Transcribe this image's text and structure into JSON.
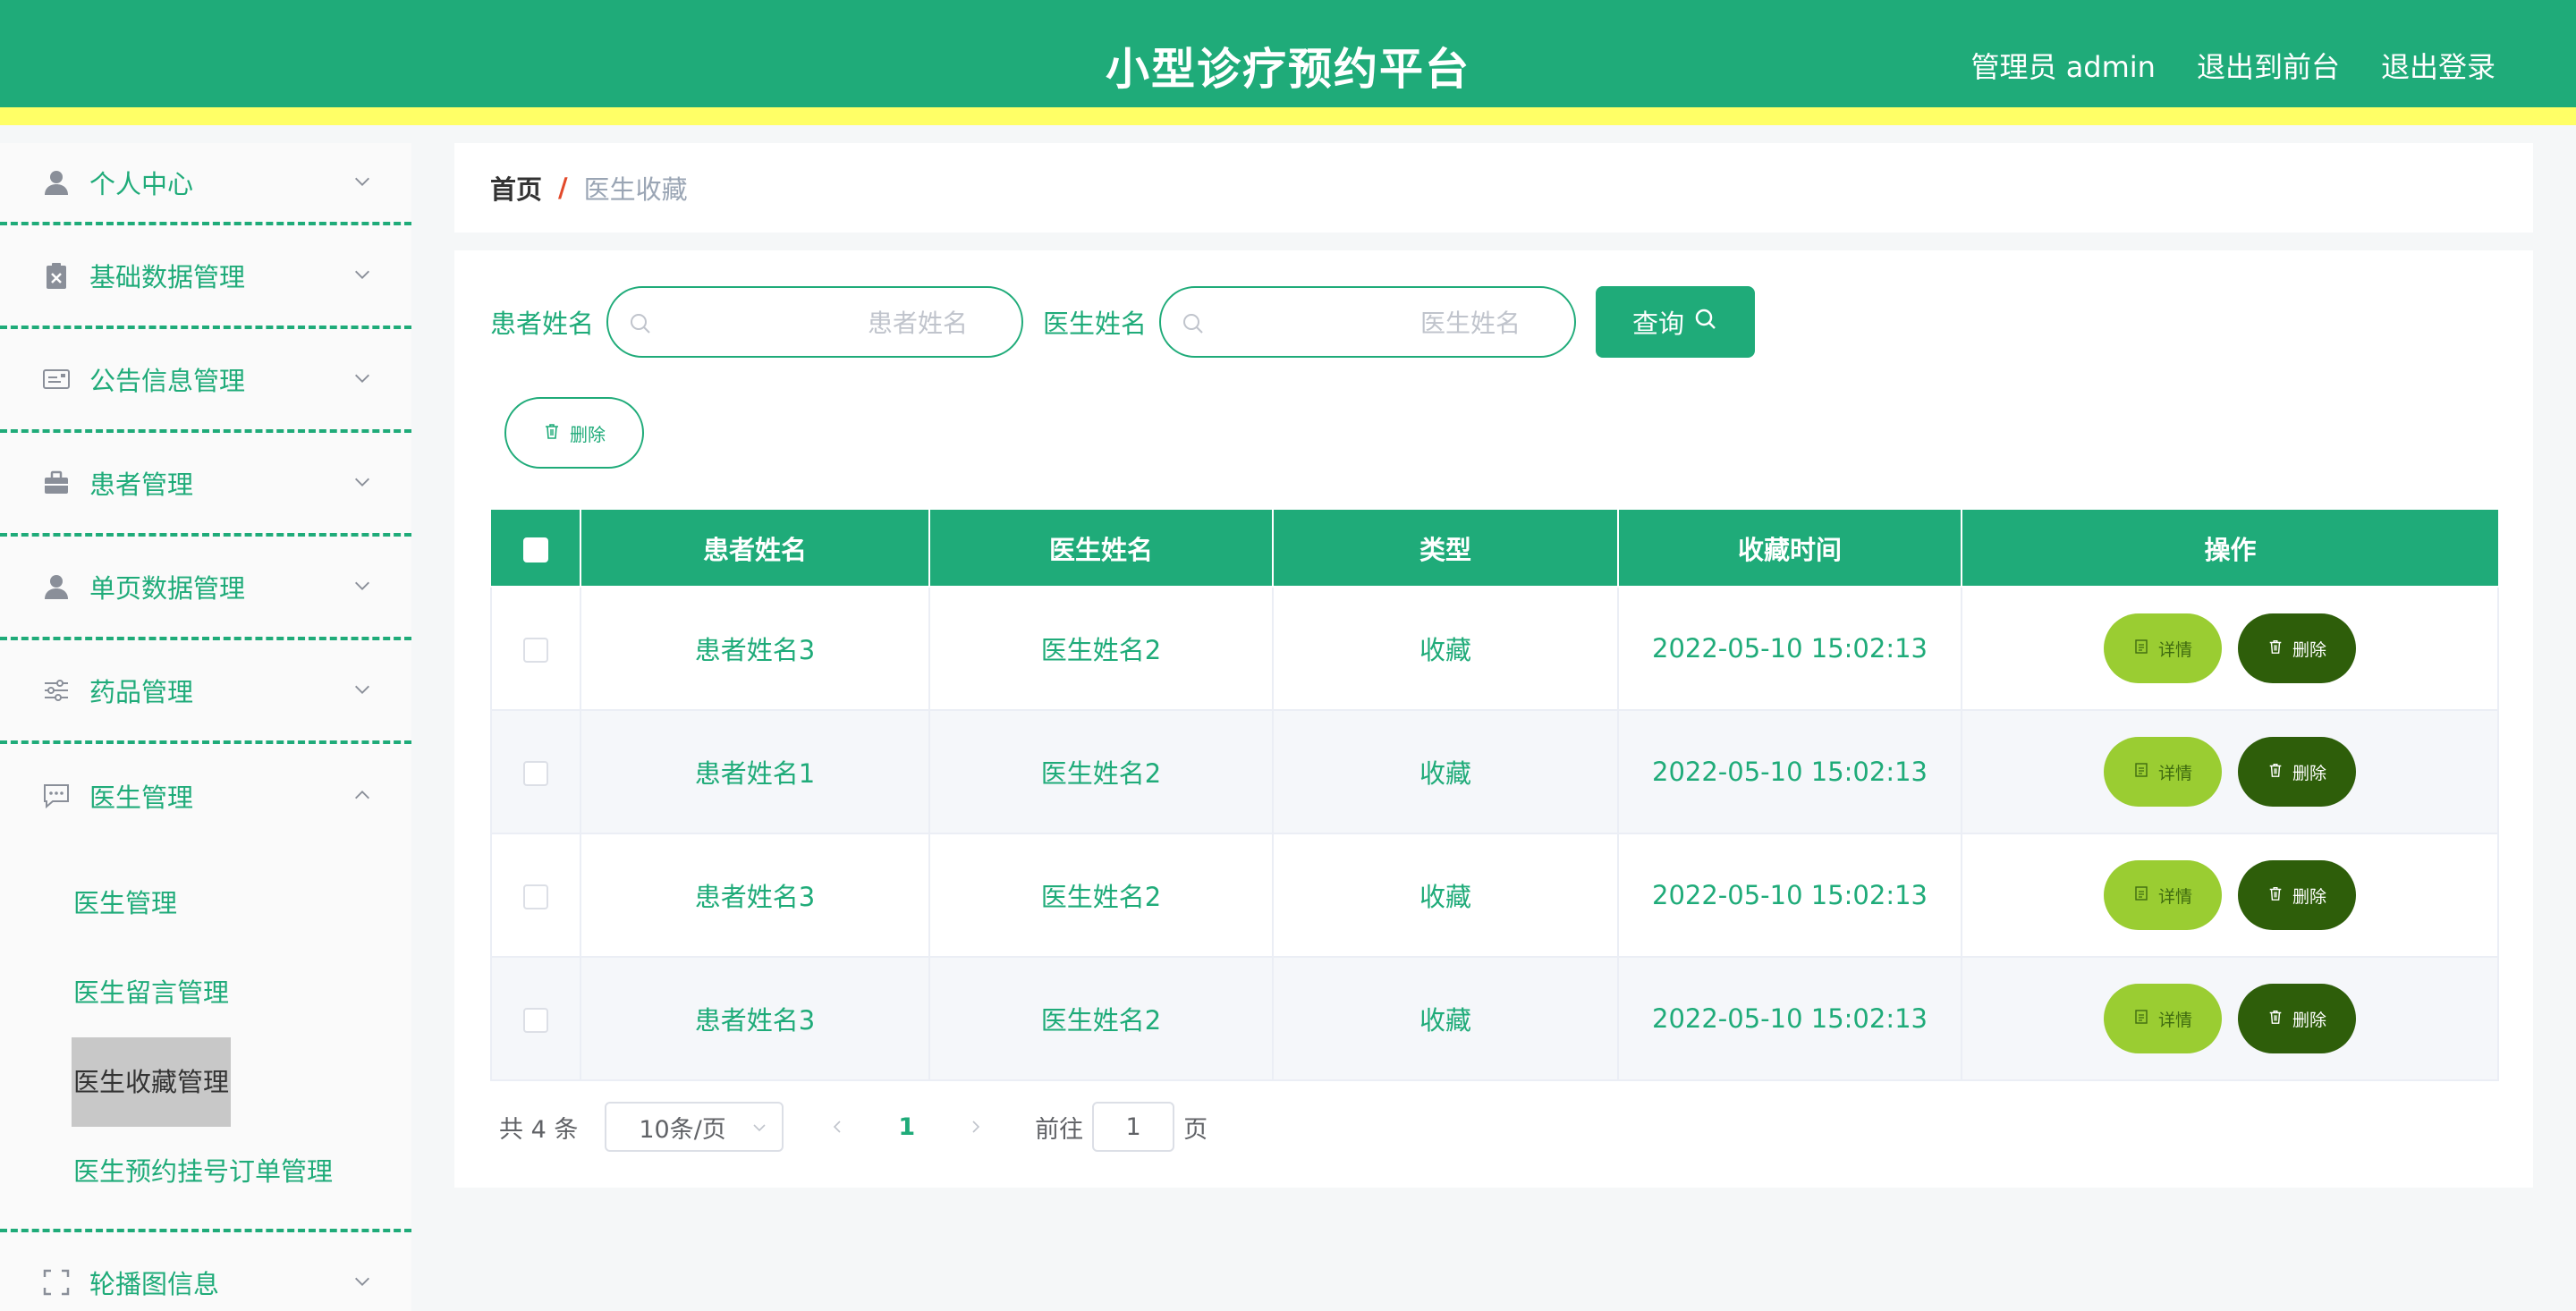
{
  "app": {
    "title": "小型诊疗预约平台",
    "admin_label": "管理员 admin",
    "to_front_label": "退出到前台",
    "logout_label": "退出登录"
  },
  "sidebar": {
    "items": [
      {
        "label": "个人中心",
        "icon": "user-icon"
      },
      {
        "label": "基础数据管理",
        "icon": "clipboard-icon"
      },
      {
        "label": "公告信息管理",
        "icon": "id-card-icon"
      },
      {
        "label": "患者管理",
        "icon": "briefcase-icon"
      },
      {
        "label": "单页数据管理",
        "icon": "user-icon"
      },
      {
        "label": "药品管理",
        "icon": "sliders-icon"
      },
      {
        "label": "医生管理",
        "icon": "chat-icon",
        "expanded": true
      },
      {
        "label": "轮播图信息",
        "icon": "frame-icon"
      }
    ],
    "doctor_submenu": [
      {
        "label": "医生管理"
      },
      {
        "label": "医生留言管理"
      },
      {
        "label": "医生收藏管理",
        "active": true
      },
      {
        "label": "医生预约挂号订单管理"
      }
    ]
  },
  "breadcrumb": {
    "home": "首页",
    "separator": "/",
    "current": "医生收藏"
  },
  "search": {
    "patient_label": "患者姓名",
    "patient_placeholder": "患者姓名",
    "doctor_label": "医生姓名",
    "doctor_placeholder": "医生姓名",
    "query_label": "查询"
  },
  "toolbar": {
    "delete_label": "删除"
  },
  "table": {
    "columns": [
      "患者姓名",
      "医生姓名",
      "类型",
      "收藏时间",
      "操作"
    ],
    "rows": [
      {
        "patient": "患者姓名3",
        "doctor": "医生姓名2",
        "type": "收藏",
        "time": "2022-05-10 15:02:13"
      },
      {
        "patient": "患者姓名1",
        "doctor": "医生姓名2",
        "type": "收藏",
        "time": "2022-05-10 15:02:13"
      },
      {
        "patient": "患者姓名3",
        "doctor": "医生姓名2",
        "type": "收藏",
        "time": "2022-05-10 15:02:13"
      },
      {
        "patient": "患者姓名3",
        "doctor": "医生姓名2",
        "type": "收藏",
        "time": "2022-05-10 15:02:13"
      }
    ],
    "detail_label": "详情",
    "delete_label": "删除"
  },
  "pagination": {
    "total": "共 4 条",
    "page_size": "10条/页",
    "current_page": "1",
    "goto_prefix": "前往",
    "goto_value": "1",
    "goto_suffix": "页"
  },
  "colors": {
    "primary": "#1fab79",
    "header_stripe": "#ffff66",
    "detail_button": "#9acd32",
    "delete_button": "#2e5e0a"
  }
}
